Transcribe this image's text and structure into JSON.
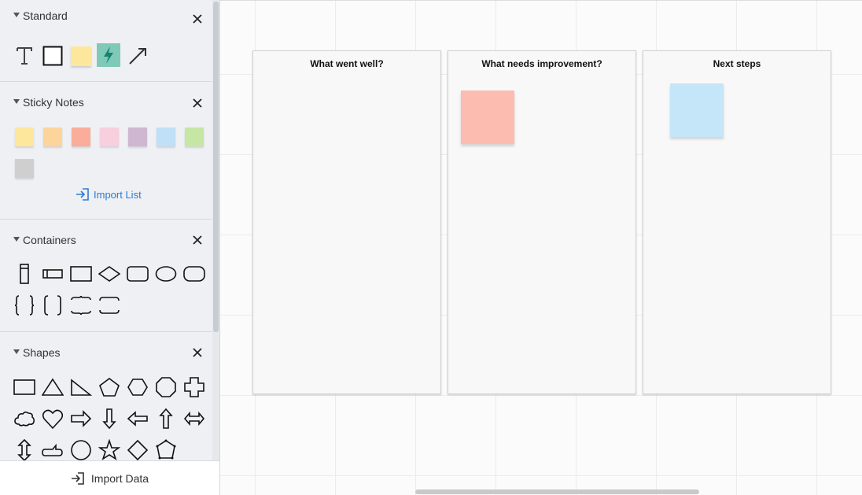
{
  "sidebar": {
    "sections": [
      {
        "title": "Standard"
      },
      {
        "title": "Sticky Notes"
      },
      {
        "title": "Containers"
      },
      {
        "title": "Shapes"
      }
    ],
    "import_list_label": "Import List",
    "import_data_label": "Import Data",
    "sticky_note_colors": [
      "#fde79d",
      "#fdd59a",
      "#fbad9c",
      "#f8cfdc",
      "#cfb6d1",
      "#bfe0f6",
      "#c6e6a4",
      "#cfcfcf"
    ],
    "standard_tools": [
      "text-icon",
      "rectangle-icon",
      "sticky-note-icon",
      "lightning-icon",
      "arrow-line-icon"
    ],
    "container_shapes": [
      "vertical-bar-icon",
      "horizontal-bar-icon",
      "rectangle-container-icon",
      "diamond-container-icon",
      "rounded-rect-container-icon",
      "ellipse-container-icon",
      "pill-container-icon",
      "curly-braces-icon",
      "brackets-icon",
      "horizontal-braces-icon",
      "horizontal-brackets-icon"
    ],
    "shapes": [
      "rectangle-icon",
      "triangle-icon",
      "right-triangle-icon",
      "pentagon-icon",
      "hexagon-icon",
      "octagon-icon",
      "cross-icon",
      "cloud-icon",
      "heart-icon",
      "right-arrow-icon",
      "down-arrow-icon",
      "left-arrow-icon",
      "up-arrow-icon",
      "left-right-arrow-icon",
      "up-down-arrow-icon",
      "callout-icon",
      "circle-icon",
      "star-icon",
      "diamond-icon",
      "pentagon-selected-icon"
    ]
  },
  "canvas": {
    "panels": [
      {
        "title": "What went well?"
      },
      {
        "title": "What needs improvement?"
      },
      {
        "title": "Next steps"
      }
    ],
    "stickies": [
      {
        "panel": "What needs improvement?",
        "color": "#fdbcb0"
      },
      {
        "panel": "Next steps",
        "color": "#c5e5f8"
      }
    ]
  },
  "colors": {
    "accent": "#2b7ad6",
    "lightning_tile": "#7fc9b9",
    "lightning_bolt": "#19806b"
  }
}
